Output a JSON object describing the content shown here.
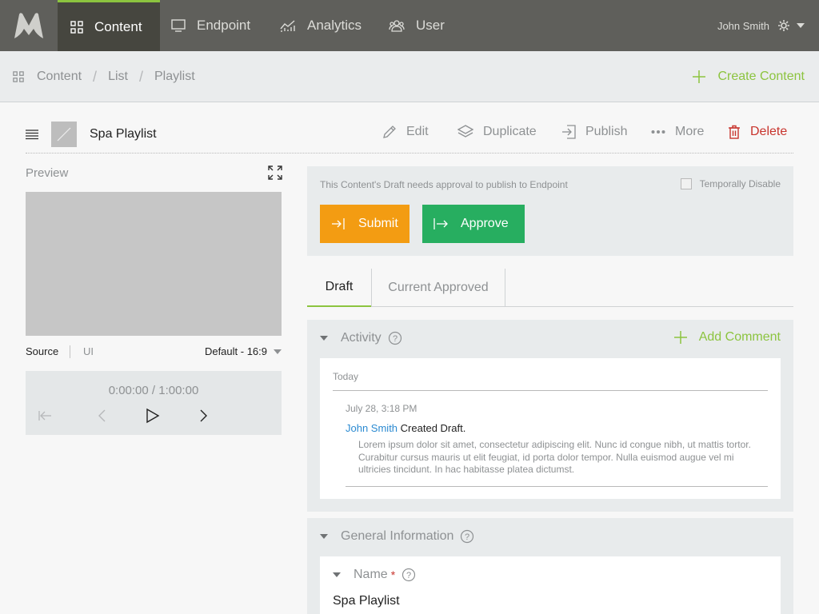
{
  "nav": {
    "items": [
      {
        "label": "Content",
        "icon": "grid-icon",
        "active": true
      },
      {
        "label": "Endpoint",
        "icon": "monitor-icon"
      },
      {
        "label": "Analytics",
        "icon": "chart-icon"
      },
      {
        "label": "User",
        "icon": "users-icon"
      }
    ],
    "user_name": "John Smith"
  },
  "breadcrumb": [
    "Content",
    "List",
    "Playlist"
  ],
  "create_label": "Create Content",
  "content": {
    "title": "Spa Playlist",
    "actions": {
      "edit": "Edit",
      "duplicate": "Duplicate",
      "publish": "Publish",
      "more": "More",
      "delete": "Delete"
    }
  },
  "preview": {
    "label": "Preview",
    "source_tab": "Source",
    "ui_tab": "UI",
    "ratio": "Default - 16:9",
    "time": "0:00:00 / 1:00:00"
  },
  "approval": {
    "message": "This Content's Draft needs approval to publish to Endpoint",
    "disable_label": "Temporally Disable",
    "submit": "Submit",
    "approve": "Approve"
  },
  "tabs": [
    "Draft",
    "Current Approved"
  ],
  "activity": {
    "title": "Activity",
    "add_comment": "Add Comment",
    "group": "Today",
    "entry": {
      "date": "July 28, 3:18 PM",
      "user": "John Smith",
      "action": "Created Draft.",
      "text": "Lorem ipsum dolor sit amet, consectetur adipiscing elit. Nunc id congue nibh, ut mattis tortor. Curabitur cursus mauris ut elit feugiat, id porta dolor tempor. Nulla euismod augue vel mi ultricies tincidunt. In hac habitasse platea dictumst."
    }
  },
  "general": {
    "title": "General Information",
    "name_label": "Name",
    "required_mark": "*",
    "name_value": "Spa Playlist"
  },
  "colors": {
    "accent_green": "#8cc43f",
    "submit_orange": "#f39c12",
    "approve_green": "#27ae60",
    "delete_red": "#c8342d",
    "link_blue": "#2b8ad1",
    "topbar": "#5f5f5b"
  }
}
